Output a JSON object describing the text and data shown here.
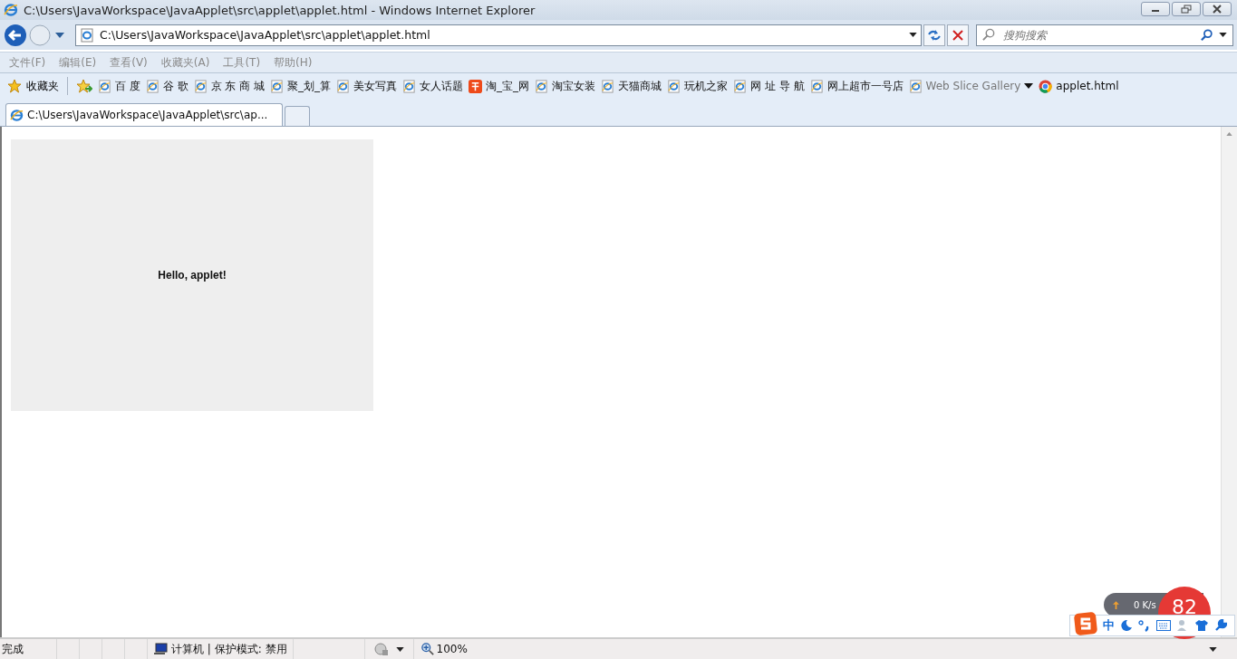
{
  "window": {
    "title": "C:\\Users\\JavaWorkspace\\JavaApplet\\src\\applet\\applet.html - Windows Internet Explorer"
  },
  "address_bar": {
    "value": "C:\\Users\\JavaWorkspace\\JavaApplet\\src\\applet\\applet.html"
  },
  "search": {
    "placeholder": "搜狗搜索"
  },
  "menu": [
    "文件(F)",
    "编辑(E)",
    "查看(V)",
    "收藏夹(A)",
    "工具(T)",
    "帮助(H)"
  ],
  "favorites": {
    "label": "收藏夹",
    "items": [
      {
        "label": "百 度",
        "kind": "ie"
      },
      {
        "label": "谷 歌",
        "kind": "ie"
      },
      {
        "label": "京 东 商 城",
        "kind": "ie"
      },
      {
        "label": "聚_划_算",
        "kind": "ie"
      },
      {
        "label": "美女写真",
        "kind": "ie"
      },
      {
        "label": "女人话题",
        "kind": "ie"
      },
      {
        "label": "淘_宝_网",
        "kind": "taobao"
      },
      {
        "label": "淘宝女装",
        "kind": "ie"
      },
      {
        "label": "天猫商城",
        "kind": "ie"
      },
      {
        "label": "玩机之家",
        "kind": "ie"
      },
      {
        "label": "网 址 导 航",
        "kind": "ie"
      },
      {
        "label": "网上超市一号店",
        "kind": "ie"
      },
      {
        "label": "Web Slice Gallery",
        "kind": "gallery"
      },
      {
        "label": "applet.html",
        "kind": "chrome"
      }
    ]
  },
  "tabs": [
    {
      "label": "C:\\Users\\JavaWorkspace\\JavaApplet\\src\\ap...",
      "selected": true
    }
  ],
  "applet": {
    "text": "Hello, applet!"
  },
  "speed_widget": {
    "speed": "0 K/s",
    "value": "82"
  },
  "ime_toolbar": {
    "mode": "中"
  },
  "status_bar": {
    "status": "完成",
    "zone": "计算机 | 保护模式: 禁用",
    "zoom": "100%"
  }
}
